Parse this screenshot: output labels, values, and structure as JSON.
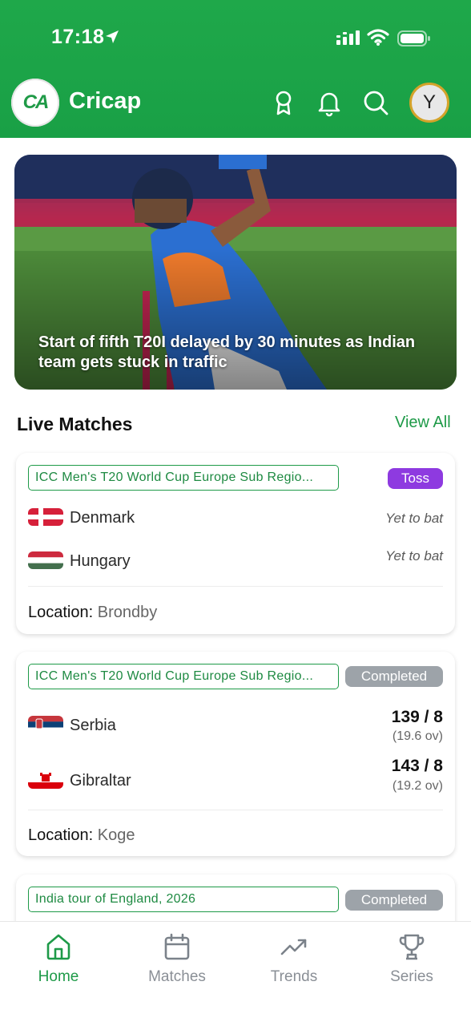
{
  "status_bar": {
    "time": "17:18"
  },
  "app": {
    "title": "Cricap",
    "logo_text": "CA"
  },
  "header": {
    "avatar_letter": "Y"
  },
  "hero": {
    "caption": "Start of fifth T20I delayed by 30 minutes as Indian team gets stuck in traffic"
  },
  "live": {
    "title": "Live Matches",
    "view_all": "View All",
    "matches": [
      {
        "tour": "ICC Men's T20 World Cup Europe Sub Regio...",
        "status": "Toss",
        "teams": [
          {
            "name": "Denmark",
            "info": "Yet to bat"
          },
          {
            "name": "Hungary",
            "info": "Yet to bat"
          }
        ],
        "location_label": "Location:",
        "location": "Brondby"
      },
      {
        "tour": "ICC Men's T20 World Cup Europe Sub Regio...",
        "status": "Completed",
        "teams": [
          {
            "name": "Serbia",
            "score": "139 / 8",
            "overs": "(19.6 ov)"
          },
          {
            "name": "Gibraltar",
            "score": "143 / 8",
            "overs": "(19.2 ov)"
          }
        ],
        "location_label": "Location:",
        "location": "Koge"
      },
      {
        "tour": "India tour of England, 2026",
        "status": "Completed"
      }
    ]
  },
  "nav": {
    "items": [
      {
        "label": "Home",
        "icon": "home-icon"
      },
      {
        "label": "Matches",
        "icon": "calendar-icon"
      },
      {
        "label": "Trends",
        "icon": "trending-up-icon"
      },
      {
        "label": "Series",
        "icon": "trophy-icon"
      }
    ]
  },
  "colors": {
    "brand": "#1fa84a",
    "accent_green": "#1e9a48",
    "toss": "#8e3ae0",
    "completed": "#9da3a9",
    "avatar_ring": "#d4a32a"
  }
}
